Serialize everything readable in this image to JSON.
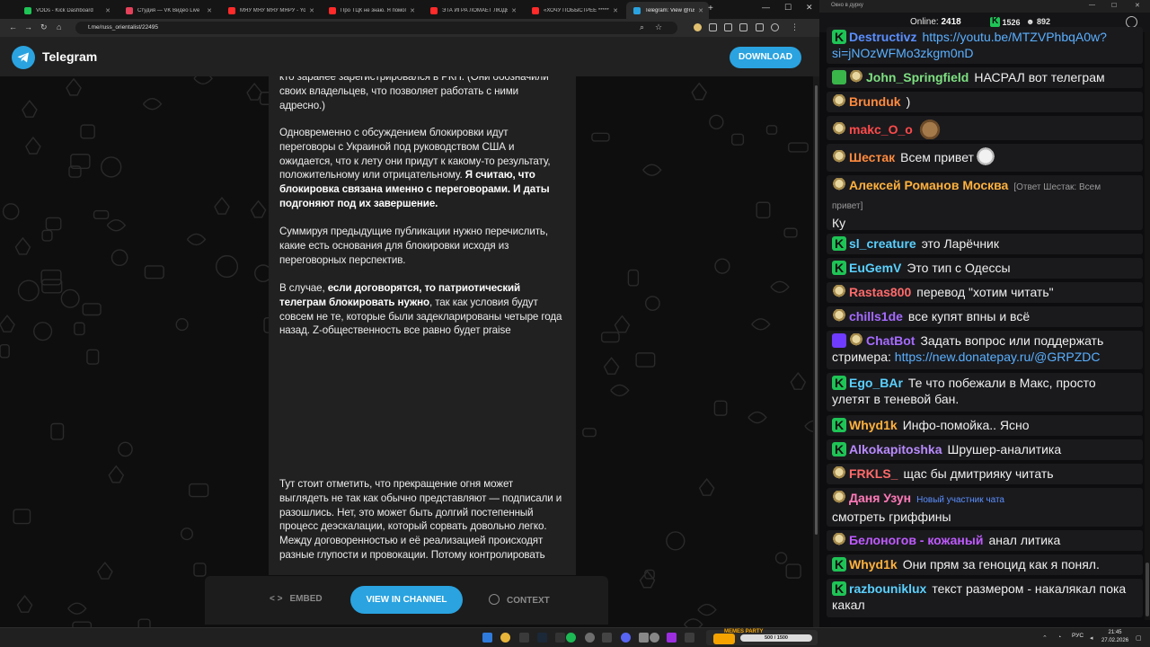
{
  "browser": {
    "tabs": [
      {
        "label": "VODs - Kick Dashboard",
        "color": "#1fc456"
      },
      {
        "label": "Студия — VK Видео Live",
        "color": "#e4415a"
      },
      {
        "label": "МЯУ МЯУ МЯУ МЯРУ - Yo",
        "color": "#ff2a2a"
      },
      {
        "label": "Про ТЦК не знаю. Я помогу",
        "color": "#ff2a2a"
      },
      {
        "label": "ЭТА ИГРА ЛОМАЕТ ЛЮДЕЙ",
        "color": "#ff2a2a"
      },
      {
        "label": "«ХОЧУ ПОБЫСТРЕЕ *******",
        "color": "#ff2a2a"
      },
      {
        "label": "Telegram: View @russ_orient",
        "color": "#2aa3e0"
      }
    ],
    "new_tab": "+",
    "url": "t.me/russ_orientalist/22495"
  },
  "telegram": {
    "brand": "Telegram",
    "download_label": "DOWNLOAD",
    "post_paragraphs": [
      {
        "pre": "кто заранее зарегистрировался в РКН. (Они обозначили своих владельцев, что позволяет работать с ними адресно.)",
        "bold": "",
        "post": ""
      },
      {
        "pre": "Одновременно с обсуждением блокировки идут переговоры с Украиной под руководством США и ожидается, что к лету они придут к какому-то результату, положительному или отрицательному. ",
        "bold": "Я считаю, что блокировка связана именно с переговорами. И даты подгоняют под их завершение.",
        "post": ""
      },
      {
        "pre": "Суммируя предыдущие публикации нужно перечислить, какие есть основания для блокировки исходя из переговорных перспектив.",
        "bold": "",
        "post": ""
      },
      {
        "pre": "В случае, ",
        "bold": "если договорятся, то патриотический телеграм блокировать нужно",
        "post": ", так как условия будут совсем не те, которые были задекларированы четыре года назад. Z-общественность все равно будет praise"
      },
      {
        "pre": "Тут стоит отметить, что прекращение огня может выглядеть не так как обычно представляют — подписали и разошлись. Нет, это может быть долгий постепенный процесс деэскалации, который сорвать довольно легко. Между договоренностью и её реализацией происходят разные глупости и провокации. Потому контролировать",
        "bold": "",
        "post": ""
      }
    ],
    "embed_label": "EMBED",
    "view_label": "VIEW IN CHANNEL",
    "context_label": "CONTEXT"
  },
  "chat": {
    "window_title": "Окно в дурку",
    "online_label": "Online:",
    "online_count": "2418",
    "kick_count": "1526",
    "gold_count": "892",
    "messages": [
      {
        "badges": [
          "kick"
        ],
        "user": "Destructivz",
        "color": "#5a8fff",
        "text": "",
        "link": "https://youtu.be/MTZVPhbqA0w?si=jNOzWFMo3zkgm0nD",
        "reply": "",
        "tag": "",
        "emote": ""
      },
      {
        "badges": [
          "pencil",
          "avatar"
        ],
        "user": "John_Springfield",
        "color": "#7ee081",
        "text": "НАСРАЛ вот телеграм",
        "link": "",
        "reply": "",
        "tag": "",
        "emote": ""
      },
      {
        "badges": [
          "avatar"
        ],
        "user": "Brunduk",
        "color": "#ff8a3d",
        "text": ")",
        "link": "",
        "reply": "",
        "tag": "",
        "emote": ""
      },
      {
        "badges": [
          "avatar"
        ],
        "user": "makc_O_o",
        "color": "#ff4a4a",
        "text": "",
        "link": "",
        "reply": "",
        "tag": "",
        "emote": "mouse"
      },
      {
        "badges": [
          "avatar"
        ],
        "user": "Шестак",
        "color": "#ff8a3d",
        "text": "Всем привет",
        "link": "",
        "reply": "",
        "tag": "",
        "emote": "bird"
      },
      {
        "badges": [
          "avatar"
        ],
        "user": "Алексей Романов Москва",
        "color": "#ffb13d",
        "text": "Ку",
        "link": "",
        "reply": "[Ответ Шестак: Всем привет]",
        "tag": "",
        "emote": ""
      },
      {
        "badges": [
          "kick"
        ],
        "user": "sl_creature",
        "color": "#5ad1ff",
        "text": "это Ларёчник",
        "link": "",
        "reply": "",
        "tag": "",
        "emote": ""
      },
      {
        "badges": [
          "kick"
        ],
        "user": "EuGemV",
        "color": "#5ad1ff",
        "text": "Это тип с Одессы",
        "link": "",
        "reply": "",
        "tag": "",
        "emote": ""
      },
      {
        "badges": [
          "avatar"
        ],
        "user": "Rastas800",
        "color": "#ff6a6a",
        "text": "перевод \"хотим читать\"",
        "link": "",
        "reply": "",
        "tag": "",
        "emote": ""
      },
      {
        "badges": [
          "avatar"
        ],
        "user": "chills1de",
        "color": "#a66bff",
        "text": "все купят впны и всё",
        "link": "",
        "reply": "",
        "tag": "",
        "emote": ""
      },
      {
        "badges": [
          "bot",
          "avatar"
        ],
        "user": "ChatBot",
        "color": "#a66bff",
        "text": "Задать вопрос или поддержать стримера: ",
        "link": "https://new.donatepay.ru/@GRPZDC",
        "reply": "",
        "tag": "",
        "emote": ""
      },
      {
        "badges": [
          "kick"
        ],
        "user": "Ego_BAr",
        "color": "#5ad1ff",
        "text": "Те что побежали в Макс, просто улетят в теневой бан.",
        "link": "",
        "reply": "",
        "tag": "",
        "emote": ""
      },
      {
        "badges": [
          "kick"
        ],
        "user": "Whyd1k",
        "color": "#ffb13d",
        "text": "Инфо-помойка.. Ясно",
        "link": "",
        "reply": "",
        "tag": "",
        "emote": ""
      },
      {
        "badges": [
          "kick"
        ],
        "user": "Alkokapitoshka",
        "color": "#b98bff",
        "text": "Шрушер-аналитика",
        "link": "",
        "reply": "",
        "tag": "",
        "emote": ""
      },
      {
        "badges": [
          "avatar"
        ],
        "user": "FRKLS_",
        "color": "#ff6a6a",
        "text": "щас бы дмитрияку читать",
        "link": "",
        "reply": "",
        "tag": "",
        "emote": ""
      },
      {
        "badges": [
          "avatar"
        ],
        "user": "Даня Узун",
        "color": "#ff7ab8",
        "text": "смотреть гриффины",
        "link": "",
        "reply": "",
        "tag": "Новый участник чата",
        "emote": ""
      },
      {
        "badges": [
          "avatar"
        ],
        "user": "Белоногов - кожаный",
        "color": "#c05bff",
        "text": "анал литика",
        "link": "",
        "reply": "",
        "tag": "",
        "emote": ""
      },
      {
        "badges": [
          "kick"
        ],
        "user": "Whyd1k",
        "color": "#ffb13d",
        "text": "Они прям за геноцид как я понял.",
        "link": "",
        "reply": "",
        "tag": "",
        "emote": ""
      },
      {
        "badges": [
          "kick"
        ],
        "user": "razbouniklux",
        "color": "#5ad1ff",
        "text": "текст размером - накалякал пока какал",
        "link": "",
        "reply": "",
        "tag": "",
        "emote": ""
      }
    ]
  },
  "taskbar": {
    "memes_label": "MEMES PARTY",
    "memes_progress": "500 / 1500",
    "lang": "РУС",
    "time": "21:45",
    "date": "27.02.2026"
  }
}
